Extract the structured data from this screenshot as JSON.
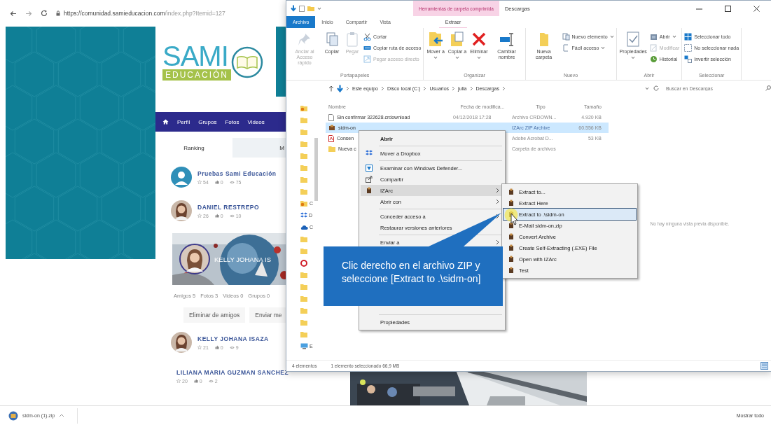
{
  "browser": {
    "url_host": "https://comunidad.samieducacion.com",
    "url_path": "/index.php?Itemid=127"
  },
  "site": {
    "logo": {
      "word": "SAMI",
      "tagline": "EDUCACIÓN"
    },
    "nav": [
      "Perfil",
      "Grupos",
      "Fotos",
      "Videos"
    ],
    "tabs": [
      {
        "label": "Ranking",
        "selected": true
      },
      {
        "label": "M",
        "selected": false
      }
    ],
    "ranking": [
      {
        "name": "Pruebas Sami Educación",
        "kind": "silhouette",
        "points": "54",
        "likes": "0",
        "views": "75"
      },
      {
        "name": "DANIEL RESTREPO",
        "points": "26",
        "likes": "0",
        "views": "10"
      }
    ],
    "profile": {
      "name": "KELLY JOHANA IS",
      "stats": [
        "Amigos 5",
        "Fotos 3",
        "Videos 0",
        "Grupos 0"
      ],
      "buttons": [
        "Eliminar de amigos",
        "Enviar me"
      ]
    },
    "friends": [
      {
        "name": "KELLY JOHANA ISAZA",
        "points": "21",
        "likes": "0",
        "views": "9"
      },
      {
        "name": "LILIANA MARIA GUZMAN SANCHEZ",
        "points": "20",
        "likes": "0",
        "views": "2"
      }
    ]
  },
  "downloads": {
    "file": "sidm-on (1).zip",
    "show_all": "Mostrar todo"
  },
  "explorer": {
    "title": "Descargas",
    "context_tab": "Herramientas de carpeta comprimida",
    "tabs": [
      {
        "label": "Archivo",
        "selected": true,
        "contextual": false
      },
      {
        "label": "Inicio",
        "selected": false,
        "contextual": false
      },
      {
        "label": "Compartir",
        "selected": false,
        "contextual": false
      },
      {
        "label": "Vista",
        "selected": false,
        "contextual": false
      },
      {
        "label": "Extraer",
        "selected": false,
        "contextual": true
      }
    ],
    "ribbon": [
      {
        "label": "Portapapeles",
        "buttons": [
          {
            "label": "Anclar al Acceso rápido",
            "kind": "large",
            "disabled": true,
            "dropdown": false
          },
          {
            "label": "Copiar",
            "kind": "large",
            "disabled": false,
            "dropdown": false
          },
          {
            "label": "Pegar",
            "kind": "large",
            "disabled": true,
            "dropdown": false
          },
          {
            "label": "Cortar",
            "kind": "small",
            "disabled": false,
            "dropdown": false
          },
          {
            "label": "Copiar ruta de acceso",
            "kind": "small",
            "disabled": false,
            "dropdown": false
          },
          {
            "label": "Pegar acceso directo",
            "kind": "small",
            "disabled": true,
            "dropdown": false
          }
        ]
      },
      {
        "label": "Organizar",
        "buttons": [
          {
            "label": "Mover a",
            "kind": "large",
            "disabled": false,
            "dropdown": true
          },
          {
            "label": "Copiar a",
            "kind": "large",
            "disabled": false,
            "dropdown": true
          },
          {
            "label": "Eliminar",
            "kind": "large",
            "disabled": false,
            "dropdown": true
          },
          {
            "label": "Cambiar nombre",
            "kind": "large",
            "disabled": false,
            "dropdown": false
          }
        ]
      },
      {
        "label": "Nuevo",
        "buttons": [
          {
            "label": "Nueva carpeta",
            "kind": "large",
            "disabled": false,
            "dropdown": false
          },
          {
            "label": "Nuevo elemento",
            "kind": "small",
            "disabled": false,
            "dropdown": true
          },
          {
            "label": "Fácil acceso",
            "kind": "small",
            "disabled": false,
            "dropdown": true
          }
        ]
      },
      {
        "label": "Abrir",
        "buttons": [
          {
            "label": "Propiedades",
            "kind": "large",
            "disabled": false,
            "dropdown": true
          },
          {
            "label": "Abrir",
            "kind": "small",
            "disabled": false,
            "dropdown": true
          },
          {
            "label": "Modificar",
            "kind": "small",
            "disabled": true,
            "dropdown": false
          },
          {
            "label": "Historial",
            "kind": "small",
            "disabled": false,
            "dropdown": false
          }
        ]
      },
      {
        "label": "Seleccionar",
        "buttons": [
          {
            "label": "Seleccionar todo",
            "kind": "small",
            "disabled": false,
            "dropdown": false
          },
          {
            "label": "No seleccionar nada",
            "kind": "small",
            "disabled": false,
            "dropdown": false
          },
          {
            "label": "Invertir selección",
            "kind": "small",
            "disabled": false,
            "dropdown": false
          }
        ]
      }
    ],
    "path": [
      "Este equipo",
      "Disco local (C:)",
      "Usuarios",
      "julia",
      "Descargas"
    ],
    "search_placeholder": "Buscar en Descargas",
    "sidebar": [
      {
        "kind": "quick"
      },
      {
        "kind": "folder"
      },
      {
        "kind": "folder"
      },
      {
        "kind": "folder"
      },
      {
        "kind": "folder"
      },
      {
        "kind": "folder"
      },
      {
        "kind": "folder"
      },
      {
        "kind": "folder"
      },
      {
        "kind": "quick",
        "label": "C"
      },
      {
        "kind": "dropbox",
        "label": "D"
      },
      {
        "kind": "onedrive",
        "label": "C"
      },
      {
        "kind": "folder"
      },
      {
        "kind": "folder"
      },
      {
        "kind": "disc"
      },
      {
        "kind": "folder"
      },
      {
        "kind": "folder"
      },
      {
        "kind": "folder"
      },
      {
        "kind": "folder"
      },
      {
        "kind": "folder"
      },
      {
        "kind": "folder"
      },
      {
        "kind": "pc",
        "label": "E"
      }
    ],
    "columns": [
      "Nombre",
      "Fecha de modifica...",
      "Tipo",
      "Tamaño"
    ],
    "files": [
      {
        "name": "Sin confirmar 322628.crdownload",
        "kind": "file",
        "date": "04/12/2018 17:28",
        "type": "Archivo CRDOWN...",
        "size": "4.920 KB",
        "selected": false
      },
      {
        "name": "sidm-on",
        "kind": "zip",
        "type": "IZArc ZIP Archive",
        "size": "60.556 KB",
        "selected": true
      },
      {
        "name": "Consen",
        "kind": "pdf",
        "type": "Adobe Acrobat D...",
        "size": "53 KB",
        "selected": false
      },
      {
        "name": "Nueva c",
        "kind": "folder",
        "type": "Carpeta de archivos",
        "selected": false
      }
    ],
    "preview": "No hay ninguna vista previa disponible.",
    "status": [
      "4 elementos",
      "1 elemento seleccionado 66,9 MB"
    ]
  },
  "context_menu": {
    "groups": [
      [
        {
          "label": "Abrir",
          "bold": true,
          "submenu": false,
          "selected": false
        }
      ],
      [
        {
          "label": "Mover a Dropbox",
          "bold": false,
          "submenu": false,
          "selected": false
        }
      ],
      [
        {
          "label": "Examinar con Windows Defender...",
          "bold": false,
          "submenu": false,
          "selected": false
        },
        {
          "label": "Compartir",
          "bold": false,
          "submenu": false,
          "selected": false
        },
        {
          "label": "IZArc",
          "bold": false,
          "submenu": true,
          "selected": true
        },
        {
          "label": "Abrir con",
          "bold": false,
          "submenu": true,
          "selected": false
        }
      ],
      [
        {
          "label": "Conceder acceso a",
          "bold": false,
          "submenu": true,
          "selected": false
        },
        {
          "label": "Restaurar versiones anteriores",
          "bold": false,
          "submenu": false,
          "selected": false
        }
      ],
      [
        {
          "label": "Enviar a",
          "bold": false,
          "submenu": true,
          "selected": false
        }
      ]
    ],
    "last": {
      "label": "Propiedades",
      "bold": false,
      "submenu": false,
      "selected": false
    }
  },
  "submenu": [
    {
      "label": "Extract to...",
      "selected": false
    },
    {
      "label": "Extract Here",
      "selected": false
    },
    {
      "label": "Extract to .\\sidm-on",
      "selected": true
    },
    {
      "label": "E-Mail sidm-on.zip",
      "selected": false
    },
    {
      "label": "Convert Archive",
      "selected": false
    },
    {
      "label": "Create Self-Extracting (.EXE) File",
      "selected": false
    },
    {
      "label": "Open with IZArc",
      "selected": false
    },
    {
      "label": "Test",
      "selected": false
    }
  ],
  "callout": "Clic derecho en el archivo ZIP y seleccione [Extract to .\\sidm-on]"
}
